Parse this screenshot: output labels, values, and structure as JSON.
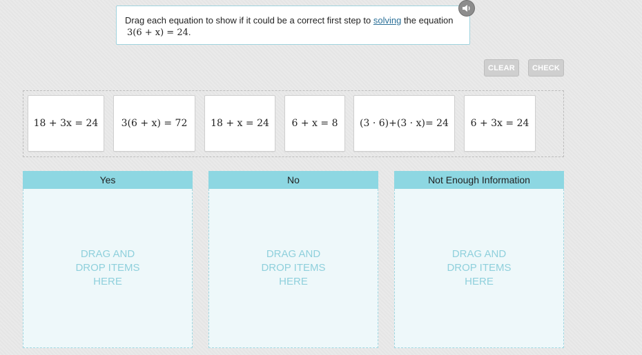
{
  "prompt": {
    "text_before": "Drag each equation to show if it could be a correct first step to ",
    "link": "solving",
    "text_after": " the equation",
    "equation": "3(6 + x) = 24",
    "period": "."
  },
  "buttons": {
    "clear": "CLEAR",
    "check": "CHECK"
  },
  "tiles": [
    "18 + 3x = 24",
    "3(6 + x) = 72",
    "18 + x = 24",
    "6 + x = 8",
    "(3 · 6)+(3 · x)= 24",
    "6 + 3x = 24"
  ],
  "bins": [
    {
      "title": "Yes",
      "drop": "DRAG AND DROP ITEMS HERE"
    },
    {
      "title": "No",
      "drop": "DRAG AND DROP ITEMS HERE"
    },
    {
      "title": "Not Enough Information",
      "drop": "DRAG AND DROP ITEMS HERE"
    }
  ],
  "colors": {
    "bin_header": "#8dd7e2",
    "bin_body": "#eef8fa",
    "drop_text": "#8fd0dc",
    "button": "#cfcfcf"
  },
  "icons": {
    "speaker": "speaker-icon"
  }
}
